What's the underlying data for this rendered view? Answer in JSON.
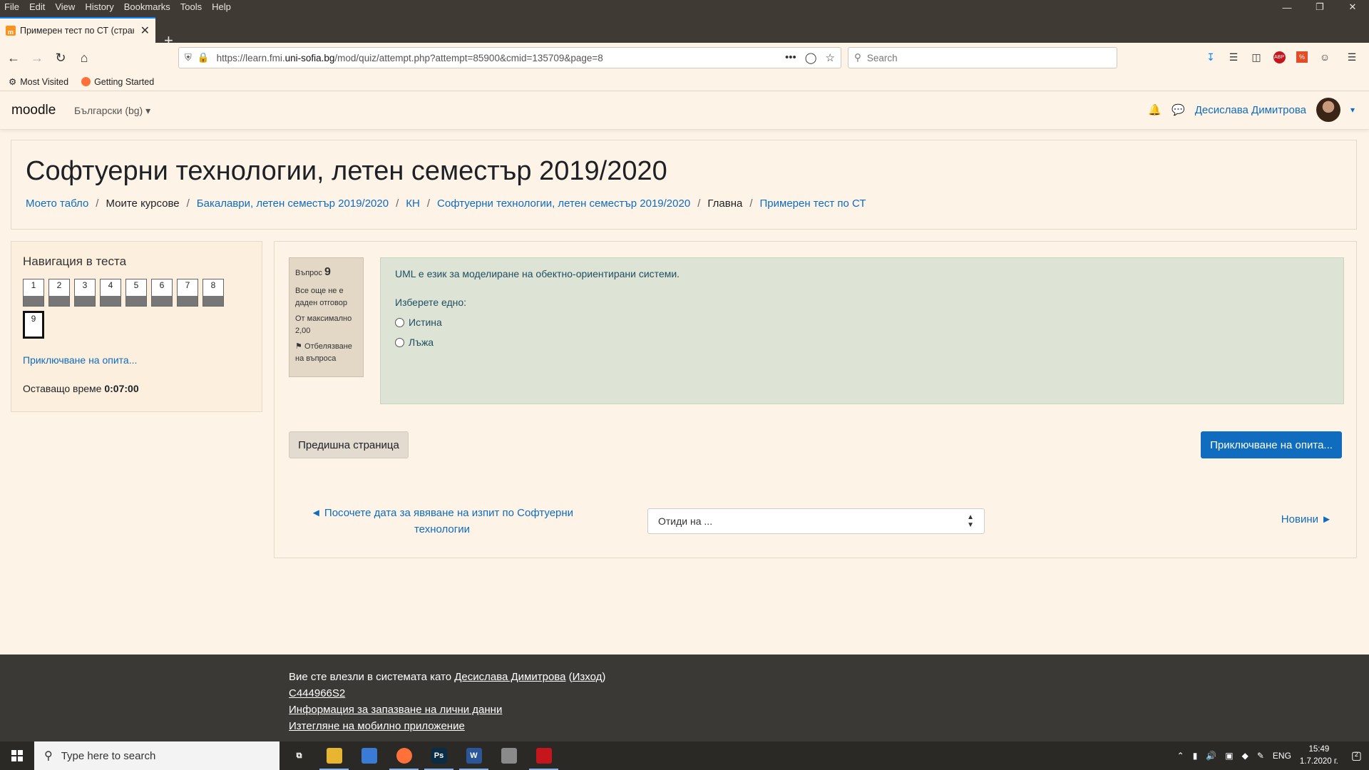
{
  "menubar": {
    "items": [
      "File",
      "Edit",
      "View",
      "History",
      "Bookmarks",
      "Tools",
      "Help"
    ]
  },
  "window_controls": [
    "minimize-icon",
    "restore-icon",
    "close-icon"
  ],
  "tab": {
    "title": "Примерен тест по СТ (страни",
    "close": "✕"
  },
  "newtab": "+",
  "url": {
    "prefix": "https://learn.fmi.",
    "domain": "uni-sofia.bg",
    "path": "/mod/quiz/attempt.php?attempt=85900&cmid=135709&page=8"
  },
  "search": {
    "placeholder": "Search"
  },
  "bookmarks": [
    {
      "label": "Most Visited",
      "icon": "gear-icon"
    },
    {
      "label": "Getting Started",
      "icon": "firefox-icon"
    }
  ],
  "moodle": {
    "brand": "moodle",
    "language": "Български (bg) ▾",
    "user_name": "Десислава Димитрова",
    "user_menu_caret": "▾"
  },
  "course": {
    "title": "Софтуерни технологии, летен семестър 2019/2020",
    "breadcrumb": [
      {
        "label": "Моето табло",
        "link": true
      },
      {
        "label": "Моите курсове",
        "link": false
      },
      {
        "label": "Бакалаври, летен семестър 2019/2020",
        "link": true
      },
      {
        "label": "КН",
        "link": true
      },
      {
        "label": "Софтуерни технологии, летен семестър 2019/2020",
        "link": true
      },
      {
        "label": "Главна",
        "link": false
      },
      {
        "label": "Примерен тест по СТ",
        "link": true
      }
    ],
    "separator": "/"
  },
  "quiz_nav": {
    "title": "Навигация в теста",
    "questions": [
      "1",
      "2",
      "3",
      "4",
      "5",
      "6",
      "7",
      "8",
      "9"
    ],
    "current": "9",
    "finish_link": "Приключване на опита...",
    "time_label": "Оставащо време ",
    "time_value": "0:07:00"
  },
  "question": {
    "label": "Въпрос",
    "number": "9",
    "status": "Все още не е даден отговор",
    "max_points": "От максимално 2,00",
    "flag": "Отбелязване на въпроса",
    "text": "UML е език за моделиране на обектно-ориентирани системи.",
    "prompt": "Изберете едно:",
    "answers": [
      "Истина",
      "Лъжа"
    ]
  },
  "buttons": {
    "prev": "Предишна страница",
    "finish": "Приключване на опита..."
  },
  "activity_nav": {
    "prev": "◄ Посочете дата за явяване на изпит по Софтуерни технологии",
    "jump_placeholder": "Отиди на ...",
    "next": "Новини ►"
  },
  "footer": {
    "logged_in_prefix": "Вие сте влезли в системата като ",
    "user": "Десислава Димитрова",
    "logout_open": " (",
    "logout": "Изход",
    "logout_close": ")",
    "code": "C444966S2",
    "privacy": "Информация за запазване на лични данни",
    "mobile_app": "Изтегляне на мобилно приложение"
  },
  "taskbar": {
    "search_placeholder": "Type here to search",
    "apps": [
      {
        "name": "task-view",
        "label": "⧉",
        "color": "#2b2926"
      },
      {
        "name": "file-explorer",
        "label": "",
        "color": "#e8b530"
      },
      {
        "name": "control-panel",
        "label": "",
        "color": "#3a7bd5"
      },
      {
        "name": "firefox",
        "label": "",
        "color": "#ff7139"
      },
      {
        "name": "photoshop",
        "label": "Ps",
        "color": "#0b2c45"
      },
      {
        "name": "word",
        "label": "W",
        "color": "#2b579a"
      },
      {
        "name": "paint",
        "label": "",
        "color": "#8a8a8a"
      },
      {
        "name": "acrobat",
        "label": "",
        "color": "#c4161c"
      }
    ],
    "lang": "ENG",
    "time": "15:49",
    "date": "1.7.2020 г.",
    "notifications": "2"
  }
}
